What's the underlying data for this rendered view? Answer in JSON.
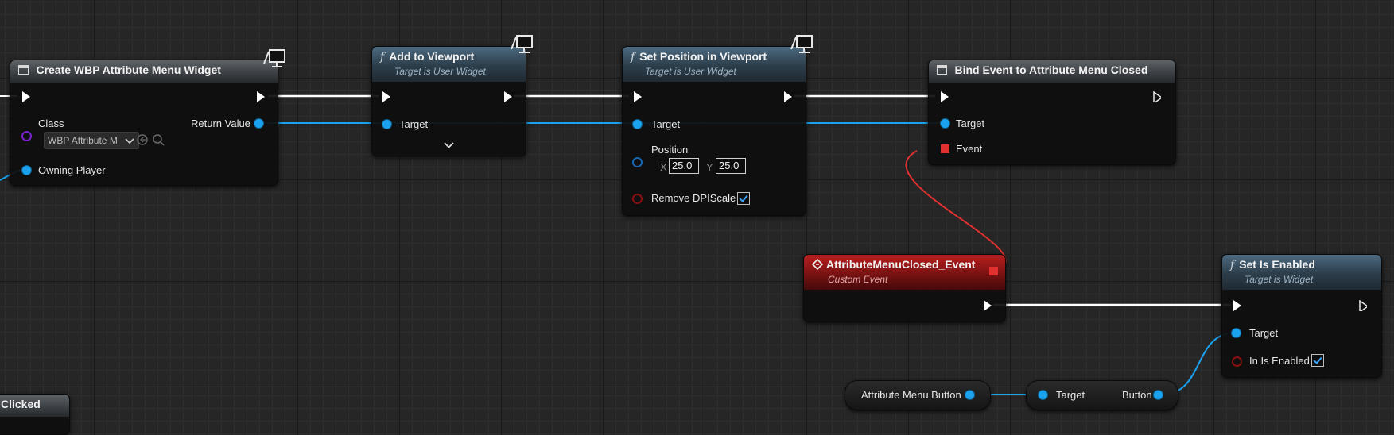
{
  "colors": {
    "exec_wire": "#ffffff",
    "object_wire": "#1ba2ee",
    "delegate_wire": "#e03030",
    "function_header": "#3a5263",
    "event_header": "#a01818"
  },
  "create_widget_node": {
    "title": "Create WBP Attribute Menu Widget",
    "icon": "widget-icon",
    "class_label": "Class",
    "class_value": "WBP Attribute M",
    "owning_player_label": "Owning Player",
    "return_value_label": "Return Value"
  },
  "add_to_viewport_node": {
    "title": "Add to Viewport",
    "subtitle": "Target is User Widget",
    "target_label": "Target",
    "expand_icon": "chevron-down-icon"
  },
  "set_position_node": {
    "title": "Set Position in Viewport",
    "subtitle": "Target is User Widget",
    "target_label": "Target",
    "position_label": "Position",
    "x_axis": "X",
    "x_value": "25.0",
    "y_axis": "Y",
    "y_value": "25.0",
    "remove_dpi_label": "Remove DPIScale"
  },
  "bind_event_node": {
    "title": "Bind Event to Attribute Menu Closed",
    "target_label": "Target",
    "event_label": "Event"
  },
  "custom_event_node": {
    "title": "AttributeMenuClosed_Event",
    "subtitle": "Custom Event"
  },
  "set_is_enabled_node": {
    "title": "Set Is Enabled",
    "subtitle": "Target is Widget",
    "target_label": "Target",
    "in_is_enabled_label": "In Is Enabled"
  },
  "attribute_menu_button_node": {
    "label": "Attribute Menu Button"
  },
  "get_button_node": {
    "target_label": "Target",
    "button_label": "Button"
  },
  "clicked_node": {
    "title": "Clicked"
  }
}
